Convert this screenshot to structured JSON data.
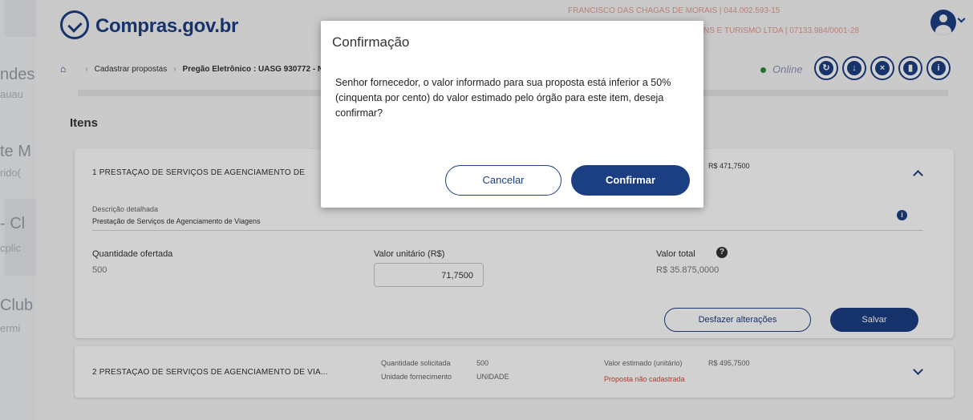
{
  "background_left": {
    "lines": [
      "ndes",
      "auau",
      "te M",
      "rido(",
      "- Cl",
      "cplic",
      "Club",
      "ermi"
    ]
  },
  "header": {
    "logo_text": "Compras.gov.br",
    "user_line1": "FRANCISCO DAS CHAGAS DE MORAIS | 044.002.593-15",
    "user_line2": "NS E TURISMO LTDA | 07133.984/0001-28"
  },
  "breadcrumb": {
    "items": [
      "Cadastrar propostas",
      "Pregão Eletrônico : UASG 930772 - Nº"
    ]
  },
  "status": {
    "online_label": "Online"
  },
  "toolbar": {
    "icons": [
      "refresh-icon",
      "download-icon",
      "cancel-icon",
      "clipboard-icon",
      "info-icon"
    ]
  },
  "page": {
    "section_title": "Itens"
  },
  "item1": {
    "title": "1  PRESTAÇAO DE SERVIÇOS DE AGENCIAMENTO DE",
    "estimated_value": "R$ 471,7500",
    "description_label": "Descrição detalhada",
    "description_value": "Prestação de Serviços de Agenciamento de Viagens",
    "qty_label": "Quantidade ofertada",
    "qty_value": "500",
    "unit_label": "Valor unitário (R$)",
    "unit_value": "71,7500",
    "total_label": "Valor total",
    "total_value": "R$ 35.875,0000",
    "undo_label": "Desfazer alterações",
    "save_label": "Salvar"
  },
  "item2": {
    "title": "2  PRESTAÇAO DE SERVIÇOS DE AGENCIAMENTO DE VIA...",
    "qty_requested_label": "Quantidade solicitada",
    "qty_requested_value": "500",
    "supply_unit_label": "Unidade fornecimento",
    "supply_unit_value": "UNIDADE",
    "est_label": "Valor estimado (unitário)",
    "est_value": "R$ 495,7500",
    "status": "Proposta não cadastrada"
  },
  "modal": {
    "title": "Confirmação",
    "message": "Senhor fornecedor, o valor informado para sua proposta está inferior a 50% (cinquenta por cento) do valor estimado pelo órgão para este item, deseja confirmar?",
    "cancel_label": "Cancelar",
    "confirm_label": "Confirmar"
  },
  "colors": {
    "brand": "#1c3f83",
    "warning_red": "#d44a3a",
    "online_green": "#2e8b3a"
  }
}
